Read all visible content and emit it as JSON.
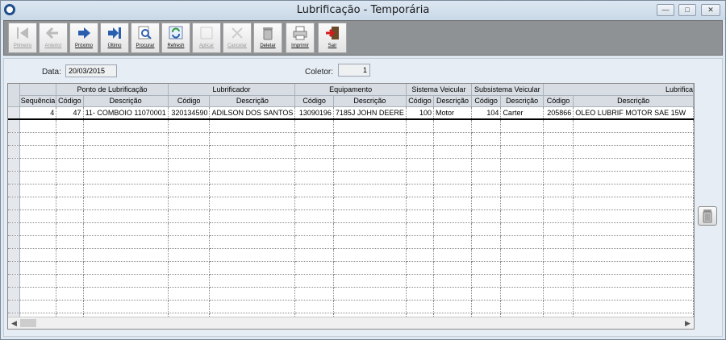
{
  "window": {
    "title": "Lubrificação - Temporária"
  },
  "toolbar": {
    "primeiro": "Primeiro",
    "anterior": "Anterior",
    "proximo": "Próximo",
    "ultimo": "Último",
    "procurar": "Procurar",
    "refresh": "Refresh",
    "aplicar": "Aplicar",
    "cancelar": "Cancelar",
    "deletar": "Deletar",
    "imprimir": "Imprimir",
    "sair": "Sair"
  },
  "form": {
    "data_label": "Data:",
    "data_value": "20/03/2015",
    "coletor_label": "Coletor:",
    "coletor_value": "1"
  },
  "grid": {
    "groups": [
      "Ponto de Lubrificação",
      "Lubrificador",
      "Equipamento",
      "Sistema Veicular",
      "Subsistema Veicular",
      "Lubrifica"
    ],
    "col_sequencia": "Sequência",
    "col_codigo": "Código",
    "col_descricao": "Descrição",
    "row": {
      "sequencia": "4",
      "ponto_codigo": "47",
      "ponto_descricao": "11- COMBOIO 11070001",
      "lubrificador_codigo": "320134590",
      "lubrificador_descricao": "ADILSON DOS SANTOS",
      "equipamento_codigo": "13090196",
      "equipamento_descricao": "7185J JOHN DEERE",
      "sistema_codigo": "100",
      "sistema_descricao": "Motor",
      "subsistema_codigo": "104",
      "subsistema_descricao": "Carter",
      "lubrificante_codigo": "205866",
      "lubrificante_descricao": "OLEO LUBRIF MOTOR SAE 15W"
    }
  },
  "icons": {
    "app": "circle-logo-icon",
    "delete_side": "trash-can-icon"
  },
  "colors": {
    "toolbar": "#8f9294",
    "grid_header": "#d8dde3"
  }
}
